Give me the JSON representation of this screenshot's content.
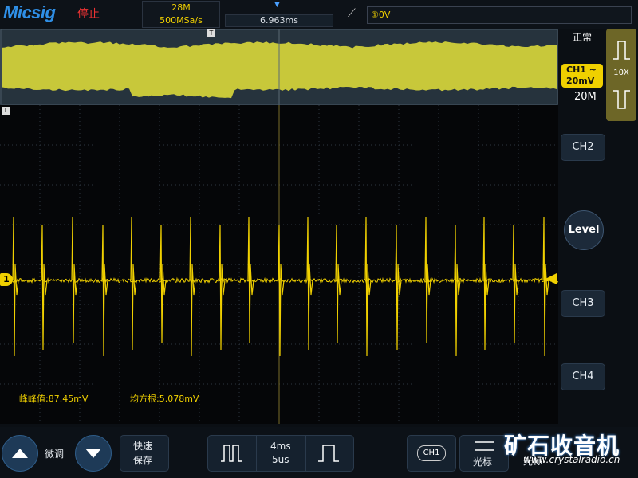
{
  "app": {
    "logo": "Micsig",
    "run_state": "停止"
  },
  "acquisition": {
    "memory_depth": "28M",
    "sample_rate": "500MSa/s"
  },
  "timebase": {
    "position": "6.963ms"
  },
  "trigger": {
    "edge_icon": "rising-edge-icon",
    "level": "①0V"
  },
  "channel1": {
    "mode": "正常",
    "name": "CH1",
    "coupling": "~",
    "volts_per_div": "20mV",
    "record_length": "20M",
    "probe": "10X",
    "marker": "1",
    "color": "#f0d000"
  },
  "measurements": {
    "vpp": "峰峰值:87.45mV",
    "rms": "均方根:5.078mV"
  },
  "right_buttons": {
    "ch2": "CH2",
    "level": "Level",
    "ch3": "CH3",
    "ch4": "CH4"
  },
  "bottom": {
    "fine_adjust": "微调",
    "quick_save_line1": "快速",
    "quick_save_line2": "保存",
    "timebase_main": "4ms",
    "timebase_zoom": "5us",
    "channel_chip": "CH1",
    "cursor": "光标",
    "auto": "光标"
  },
  "watermark": {
    "main": "矿石收音机",
    "url": "www.crystalradio.cn"
  }
}
